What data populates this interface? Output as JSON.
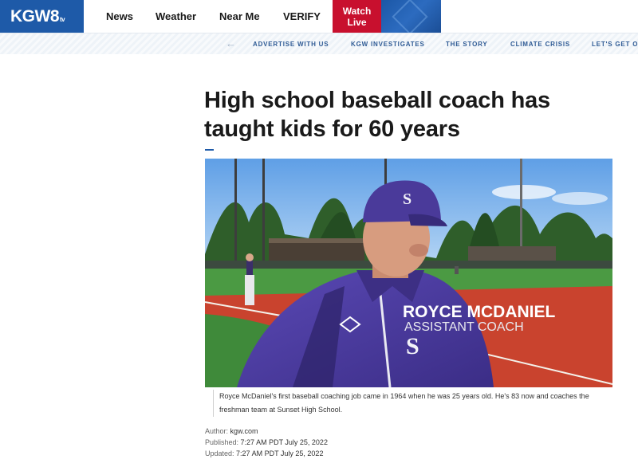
{
  "nav": {
    "logo": "KGW8",
    "logo_suffix": "tv",
    "links": [
      "News",
      "Weather",
      "Near Me",
      "VERIFY"
    ],
    "watch_line1": "Watch",
    "watch_line2": "Live"
  },
  "subnav": {
    "links": [
      "ADVERTISE WITH US",
      "KGW INVESTIGATES",
      "THE STORY",
      "CLIMATE CRISIS",
      "LET'S GET OU"
    ]
  },
  "article": {
    "headline": "High school baseball coach has taught kids for 60 years",
    "lower_third_name": "ROYCE MCDANIEL",
    "lower_third_title": "ASSISTANT COACH",
    "cap_letter": "S",
    "caption": "Royce McDaniel's first baseball coaching job came in 1964 when he was 25 years old. He's 83 now and coaches the freshman team at Sunset High School.",
    "author_label": "Author:",
    "author": "kgw.com",
    "published_label": "Published:",
    "published": "7:27 AM PDT July 25, 2022",
    "updated_label": "Updated:",
    "updated": "7:27 AM PDT July 25, 2022"
  },
  "colors": {
    "brand_blue": "#1e5aa8",
    "watch_red": "#c8102e",
    "jersey_purple": "#4b3a9c",
    "field_red": "#c9432e",
    "grass_green": "#3f8a3a"
  }
}
